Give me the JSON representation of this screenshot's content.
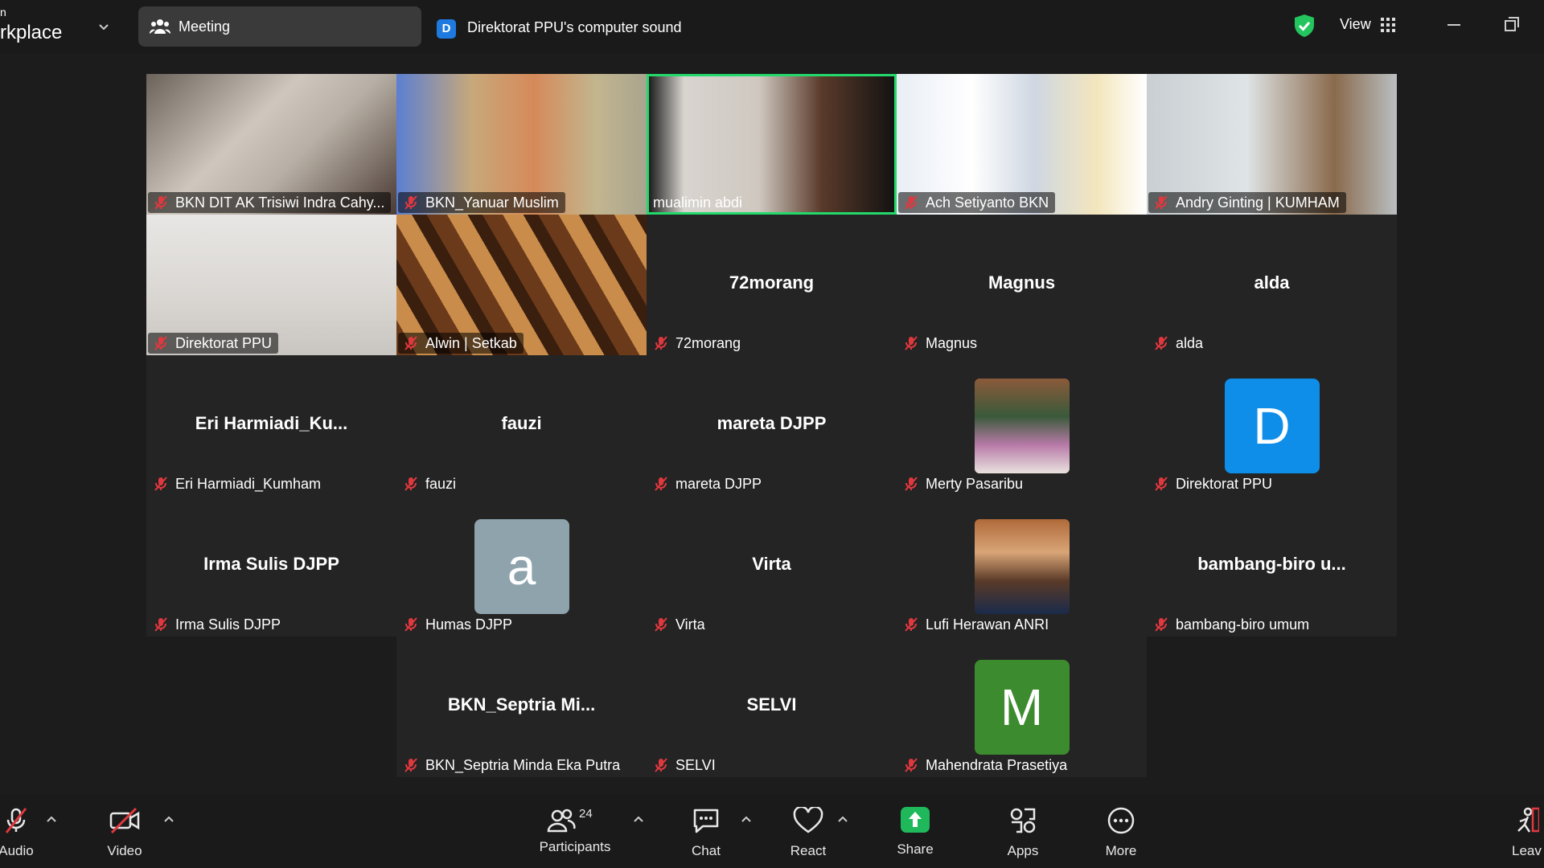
{
  "app": {
    "brand_line1": "n",
    "brand_line2": "rkplace"
  },
  "topbar": {
    "meeting_label": "Meeting",
    "sound_badge": "D",
    "sound_label": "Direktorat PPU's computer sound",
    "view_label": "View"
  },
  "tiles": [
    {
      "name": "BKN DIT AK Trisiwi Indra Cahy...",
      "kind": "video"
    },
    {
      "name": "BKN_Yanuar Muslim",
      "kind": "video"
    },
    {
      "name": "mualimin abdi",
      "kind": "video",
      "active": true
    },
    {
      "name": "Ach Setiyanto BKN",
      "kind": "video"
    },
    {
      "name": "Andry Ginting | KUMHAM",
      "kind": "video"
    },
    {
      "name": "Direktorat PPU",
      "kind": "video"
    },
    {
      "name": "Alwin | Setkab",
      "kind": "video"
    },
    {
      "name": "72morang",
      "center": "72morang"
    },
    {
      "name": "Magnus",
      "center": "Magnus"
    },
    {
      "name": "alda",
      "center": "alda"
    },
    {
      "name": "Eri Harmiadi_Kumham",
      "center": "Eri  Harmiadi_Ku..."
    },
    {
      "name": "fauzi",
      "center": "fauzi"
    },
    {
      "name": "mareta DJPP",
      "center": "mareta DJPP"
    },
    {
      "name": "Merty Pasaribu",
      "kind": "photo"
    },
    {
      "name": "Direktorat PPU",
      "avatar_letter": "D",
      "avatar_color": "#0e8ee9"
    },
    {
      "name": "Irma Sulis DJPP",
      "center": "Irma Sulis DJPP"
    },
    {
      "name": "Humas DJPP",
      "avatar_letter": "a",
      "avatar_color": "#8fa3ad"
    },
    {
      "name": "Virta",
      "center": "Virta"
    },
    {
      "name": "Lufi Herawan ANRI",
      "kind": "photo"
    },
    {
      "name": "bambang-biro umum",
      "center": "bambang-biro  u..."
    },
    {
      "name": "BKN_Septria Minda Eka Putra",
      "center": "BKN_Septria  Mi..."
    },
    {
      "name": "SELVI",
      "center": "SELVI"
    },
    {
      "name": "Mahendrata Prasetiya",
      "avatar_letter": "M",
      "avatar_color": "#3d8b2f"
    }
  ],
  "toolbar": {
    "audio": "Audio",
    "video": "Video",
    "participants": "Participants",
    "participants_count": "24",
    "chat": "Chat",
    "react": "React",
    "share": "Share",
    "apps": "Apps",
    "more": "More",
    "leave": "Leav"
  },
  "colors": {
    "active_border": "#23d96b",
    "muted_red": "#e0383e",
    "share_green": "#1fb95c",
    "badge_blue": "#1f7ae0"
  }
}
